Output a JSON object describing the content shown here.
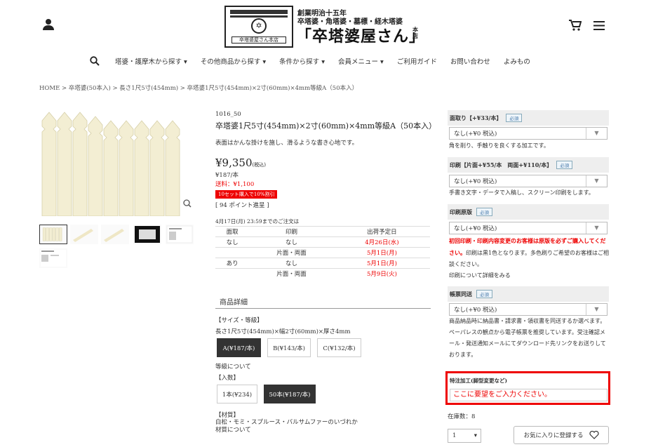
{
  "header": {
    "logo": {
      "stamp_text": "卒塔婆屋さん本店",
      "line1": "創業明治十五年",
      "line2": "卒塔婆・角塔婆・墓標・経木塔婆",
      "main": "「卒塔婆屋さん」",
      "sub": "本店"
    }
  },
  "nav": [
    {
      "label": "塔婆・護摩木から探す",
      "chev": "▾"
    },
    {
      "label": "その他商品から探す",
      "chev": "▾"
    },
    {
      "label": "条件から探す",
      "chev": "▾"
    },
    {
      "label": "会員メニュー",
      "chev": "▾"
    },
    {
      "label": "ご利用ガイド",
      "chev": ""
    },
    {
      "label": "お問い合わせ",
      "chev": ""
    },
    {
      "label": "よみもの",
      "chev": ""
    }
  ],
  "breadcrumb": "HOME > 卒塔婆(50本入) > 長さ1尺5寸(454mm) > 卒塔婆1尺5寸(454mm)×2寸(60mm)×4mm等級A（50本入）",
  "product": {
    "code": "1016_50",
    "title": "卒塔婆1尺5寸(454mm)×2寸(60mm)×4mm等級A（50本入）",
    "description": "表面はかんな掛けを施し、滑るような書き心地です。",
    "price": "¥9,350",
    "tax_note": "(税込)",
    "unit_price": "¥187/本",
    "shipping": "送料：¥1,100",
    "discount_badge": "10セット購入で10%割引",
    "points": "[ 94 ポイント進呈 ]",
    "deadline": "4月17日(月) 23:59までのご注文は",
    "table_headers": [
      "面取",
      "印刷",
      "出荷予定日"
    ],
    "table_rows": [
      {
        "mentori": "なし",
        "print": "なし",
        "date": "4月26日(水)"
      },
      {
        "mentori": "",
        "print": "片面・両面",
        "date": "5月1日(月)"
      },
      {
        "mentori": "あり",
        "print": "なし",
        "date": "5月1日(月)"
      },
      {
        "mentori": "",
        "print": "片面・両面",
        "date": "5月9日(火)"
      }
    ]
  },
  "details": {
    "section_title": "商品詳細",
    "size_label": "【サイズ・等級】",
    "size_value": "長さ1尺5寸(454mm)×幅2寸(60mm)×厚さ4mm",
    "grades": [
      "A(¥187/本)",
      "B(¥143/本)",
      "C(¥132/本)"
    ],
    "grade_link": "等級について",
    "count_label": "【入数】",
    "counts": [
      "1本(¥234)",
      "50本(¥187/本)"
    ],
    "material_label": "【材質】",
    "material_value": "白松・モミ・スプルース・バルサムファーのいづれか",
    "material_link": "材質について"
  },
  "options": {
    "required": "必須",
    "mentori": {
      "label": "面取り【+¥33/本】",
      "value": "なし(+¥0 税込)",
      "note": "角を削り、手触りを良くする加工です。"
    },
    "print": {
      "label": "印刷【片面+¥55/本　両面+¥110/本】",
      "value": "なし(+¥0 税込)",
      "note": "手書き文字・データで入稿し、スクリーン印刷をします。"
    },
    "plate": {
      "label": "印刷原版",
      "value": "なし(+¥0 税込)",
      "note_red": "初回印刷・印刷内容変更のお客様は原版を必ずご購入してください。",
      "note_rest": "印刷は黒1色となります。多色刷りご希望のお客様はご相談ください。",
      "note_link": "印刷について詳細をみる"
    },
    "invoice": {
      "label": "帳票同送",
      "value": "なし(+¥0 税込)",
      "note": "商品納品時に納品書・請求書・領収書を同送するか選べます。ペーパレスの観点から電子帳票を推奨しています。受注確認メール・発送通知メールにてダウンロード先リンクをお送りしております。"
    },
    "special_label": "特注加工(脚型変更など)",
    "special_placeholder": "ここに要望をご入力ください。",
    "stock": "在庫数：8",
    "qty": "1",
    "favorite": "お気に入りに登録する"
  }
}
